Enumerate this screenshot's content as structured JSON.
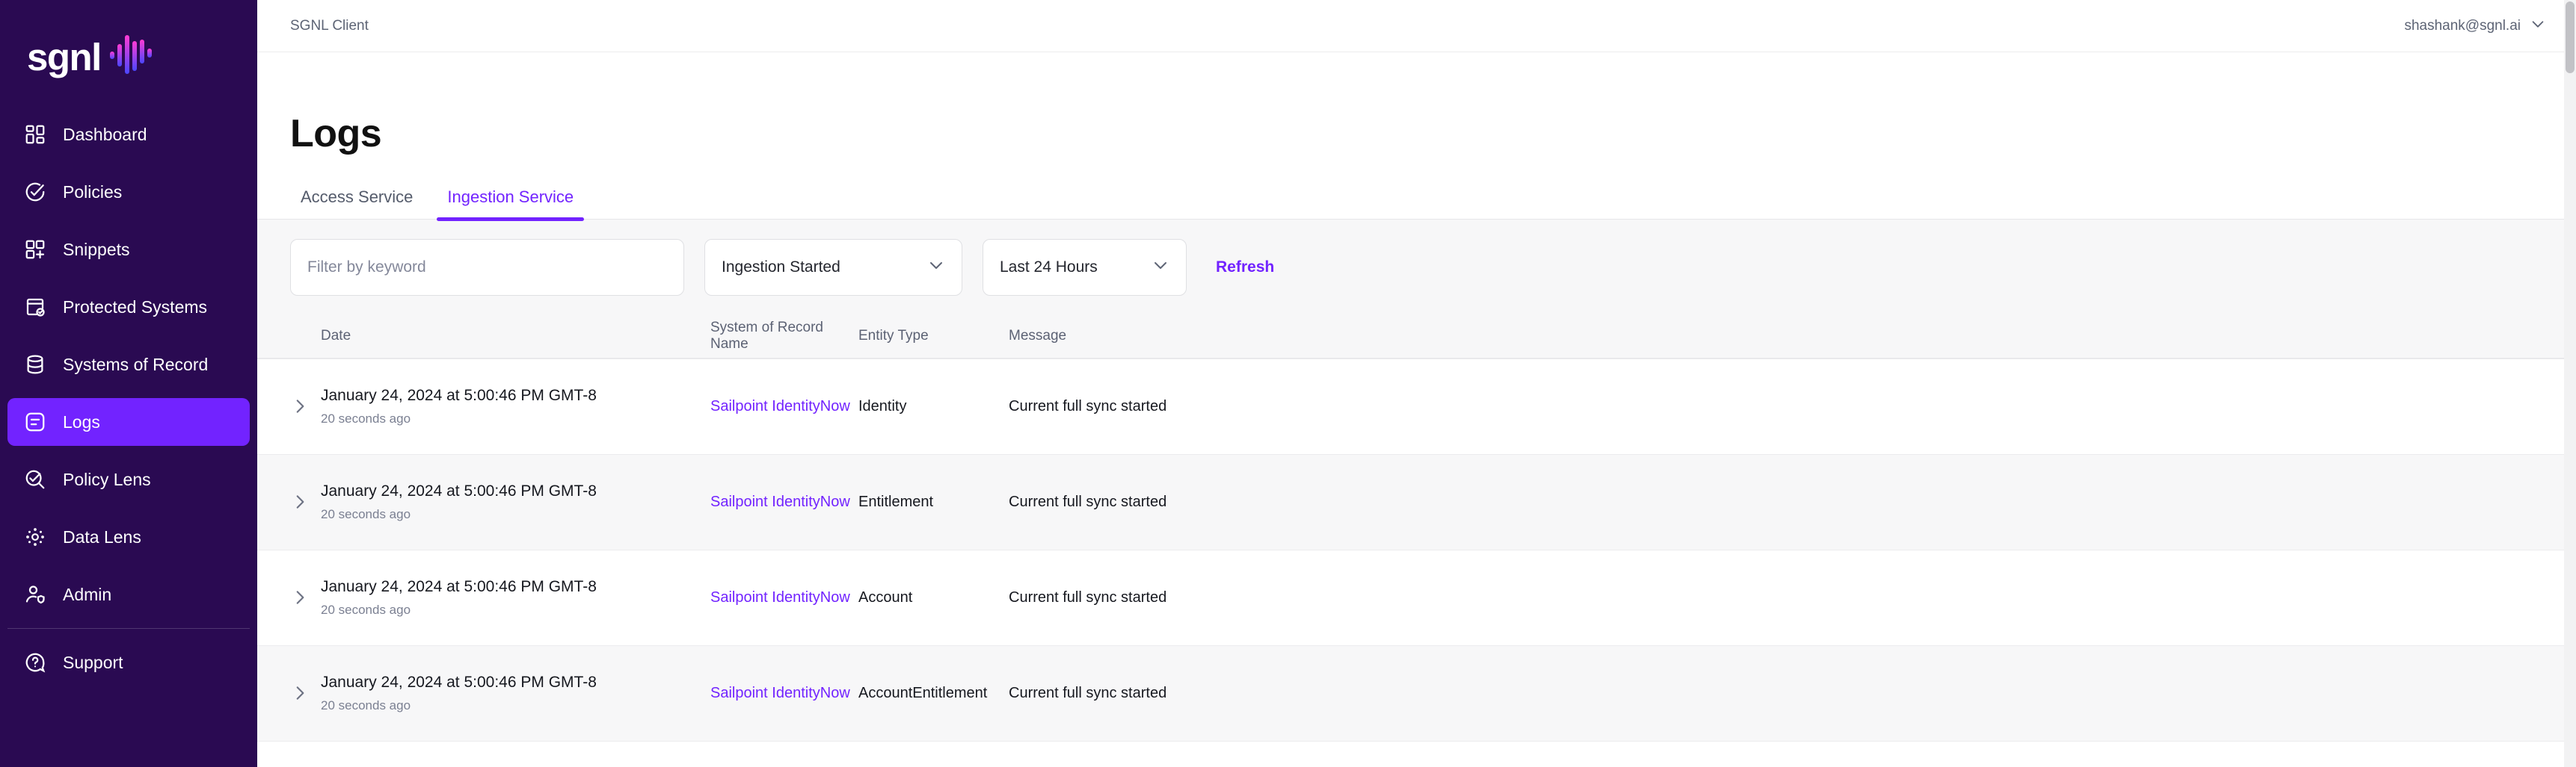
{
  "brand": {
    "name": "sgnl",
    "logo_icon": "sgnl-waveform-logo",
    "accent": "#7223ff",
    "sidebar_bg": "#2a0a52"
  },
  "sidebar": {
    "items": [
      {
        "label": "Dashboard",
        "icon": "dashboard-icon",
        "active": false
      },
      {
        "label": "Policies",
        "icon": "check-circle-icon",
        "active": false
      },
      {
        "label": "Snippets",
        "icon": "snippets-grid-plus-icon",
        "active": false
      },
      {
        "label": "Protected Systems",
        "icon": "protected-systems-icon",
        "active": false
      },
      {
        "label": "Systems of Record",
        "icon": "database-icon",
        "active": false
      },
      {
        "label": "Logs",
        "icon": "logs-icon",
        "active": true
      },
      {
        "label": "Policy Lens",
        "icon": "policy-lens-icon",
        "active": false
      },
      {
        "label": "Data Lens",
        "icon": "data-lens-icon",
        "active": false
      },
      {
        "label": "Admin",
        "icon": "admin-user-shield-icon",
        "active": false
      }
    ],
    "footer_items": [
      {
        "label": "Support",
        "icon": "question-circle-icon",
        "active": false
      }
    ]
  },
  "topbar": {
    "breadcrumb": "SGNL Client",
    "user_email": "shashank@sgnl.ai",
    "user_chevron_icon": "chevron-down-icon"
  },
  "page": {
    "title": "Logs"
  },
  "tabs": [
    {
      "label": "Access Service",
      "active": false
    },
    {
      "label": "Ingestion Service",
      "active": true
    }
  ],
  "filters": {
    "search": {
      "value": "",
      "placeholder": "Filter by keyword",
      "name": "filter-by-keyword"
    },
    "event_type": {
      "selected": "Ingestion Started",
      "chevron_icon": "chevron-down-icon"
    },
    "time_range": {
      "selected": "Last 24 Hours",
      "chevron_icon": "chevron-down-icon"
    },
    "refresh_label": "Refresh"
  },
  "table": {
    "columns": [
      "Date",
      "System of Record Name",
      "Entity Type",
      "Message"
    ],
    "expand_icon": "chevron-right-icon",
    "rows": [
      {
        "date": "January 24, 2024 at 5:00:46 PM GMT-8",
        "relative": "20 seconds ago",
        "system_of_record": "Sailpoint IdentityNow",
        "entity_type": "Identity",
        "message": "Current full sync started"
      },
      {
        "date": "January 24, 2024 at 5:00:46 PM GMT-8",
        "relative": "20 seconds ago",
        "system_of_record": "Sailpoint IdentityNow",
        "entity_type": "Entitlement",
        "message": "Current full sync started"
      },
      {
        "date": "January 24, 2024 at 5:00:46 PM GMT-8",
        "relative": "20 seconds ago",
        "system_of_record": "Sailpoint IdentityNow",
        "entity_type": "Account",
        "message": "Current full sync started"
      },
      {
        "date": "January 24, 2024 at 5:00:46 PM GMT-8",
        "relative": "20 seconds ago",
        "system_of_record": "Sailpoint IdentityNow",
        "entity_type": "AccountEntitlement",
        "message": "Current full sync started"
      }
    ]
  }
}
